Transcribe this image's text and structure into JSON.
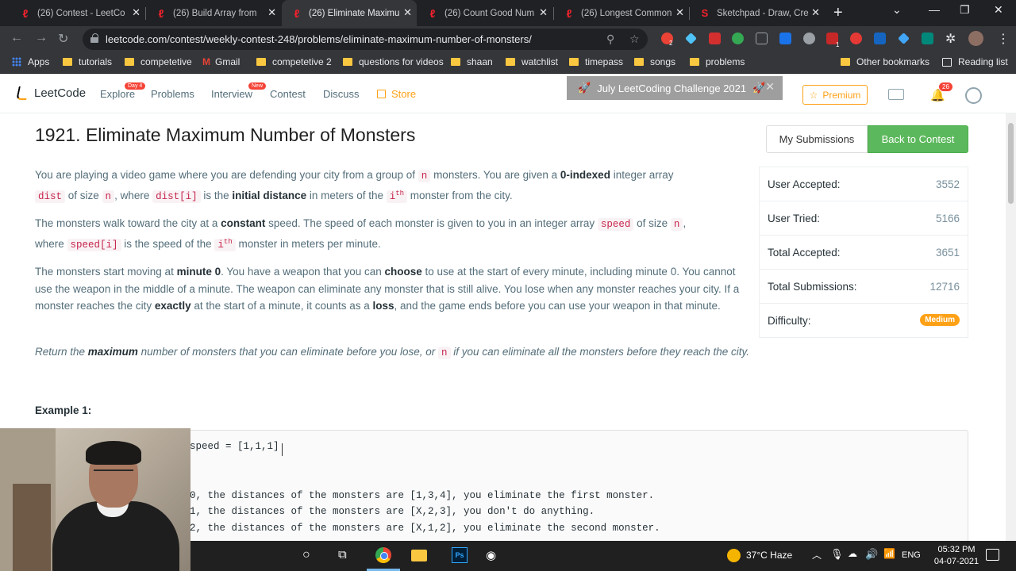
{
  "browser": {
    "tabs": [
      {
        "label": "(26) Contest - LeetCo",
        "favicon": "leetcode-icon"
      },
      {
        "label": "(26) Build Array from",
        "favicon": "leetcode-icon"
      },
      {
        "label": "(26) Eliminate Maximu",
        "favicon": "leetcode-icon",
        "active": true
      },
      {
        "label": "(26) Count Good Num",
        "favicon": "leetcode-icon"
      },
      {
        "label": "(26) Longest Common",
        "favicon": "leetcode-icon"
      },
      {
        "label": "Sketchpad - Draw, Cre",
        "favicon": "sketchpad-icon"
      }
    ],
    "url": "leetcode.com/contest/weekly-contest-248/problems/eliminate-maximum-number-of-monsters/",
    "bookmarks": [
      {
        "label": "Apps",
        "icon": "apps-grid-icon"
      },
      {
        "label": "tutorials",
        "icon": "folder-icon"
      },
      {
        "label": "competetive",
        "icon": "folder-icon"
      },
      {
        "label": "Gmail",
        "icon": "gmail-icon"
      },
      {
        "label": "competetive 2",
        "icon": "folder-icon"
      },
      {
        "label": "questions for videos",
        "icon": "folder-icon"
      },
      {
        "label": "shaan",
        "icon": "folder-icon"
      },
      {
        "label": "watchlist",
        "icon": "folder-icon"
      },
      {
        "label": "timepass",
        "icon": "folder-icon"
      },
      {
        "label": "songs",
        "icon": "folder-icon"
      },
      {
        "label": "problems",
        "icon": "folder-icon"
      },
      {
        "label": "Other bookmarks",
        "icon": "folder-icon"
      },
      {
        "label": "Reading list",
        "icon": "reading-list-icon"
      }
    ],
    "extension_badges": {
      "first": "2",
      "second": "1"
    }
  },
  "nav": {
    "logo": "LeetCode",
    "links": {
      "explore": "Explore",
      "problems": "Problems",
      "interview": "Interview",
      "contest": "Contest",
      "discuss": "Discuss",
      "store": "Store"
    },
    "badges": {
      "explore": "Day 4",
      "interview": "New"
    },
    "banner": "July LeetCoding Challenge 2021",
    "premium": "Premium",
    "notification_count": "26"
  },
  "problem": {
    "title": "1921. Eliminate Maximum Number of Monsters",
    "actions": {
      "submissions": "My Submissions",
      "back": "Back to Contest"
    },
    "p1": {
      "a": "You are playing a video game where you are defending your city from a group of ",
      "n": "n",
      "b": " monsters. You are given a ",
      "bold1": "0-indexed",
      "c": " integer array",
      "dist": "dist",
      "d": " of size ",
      "n2": "n",
      "e": ", where ",
      "disti": "dist[i]",
      "f": " is the ",
      "bold2": "initial distance",
      "g": " in meters of the ",
      "i": "i",
      "th": "th",
      "h": " monster from the city."
    },
    "p2": {
      "a": "The monsters walk toward the city at a ",
      "bold1": "constant",
      "b": " speed. The speed of each monster is given to you in an integer array ",
      "speed": "speed",
      "c": " of size ",
      "n": "n",
      "d": ",",
      "e": "where ",
      "speedi": "speed[i]",
      "f": " is the speed of the ",
      "i": "i",
      "th": "th",
      "g": " monster in meters per minute."
    },
    "p3": {
      "a": "The monsters start moving at ",
      "bold1": "minute 0",
      "b": ". You have a weapon that you can ",
      "bold2": "choose",
      "c": " to use at the start of every minute, including minute 0. You cannot use the weapon in the middle of a minute. The weapon can eliminate any monster that is still alive. You lose when any monster reaches your city. If a monster reaches the city ",
      "bold3": "exactly",
      "d": " at the start of a minute, it counts as a ",
      "bold4": "loss",
      "e": ", and the game ends before you can use your weapon in that minute."
    },
    "p4": {
      "a": "Return the ",
      "bold1": "maximum",
      "b": " number of monsters that you can eliminate before you lose, or ",
      "n": "n",
      "c": " if you can eliminate all the monsters before they reach the city."
    },
    "example_title": "Example 1:",
    "example_lines": [
      "speed = [1,1,1]",
      "0, the distances of the monsters are [1,3,4], you eliminate the first monster.",
      "1, the distances of the monsters are [X,2,3], you don't do anything.",
      "2, the distances of the monsters are [X,1,2], you eliminate the second monster."
    ]
  },
  "stats": [
    {
      "label": "User Accepted:",
      "value": "3552"
    },
    {
      "label": "User Tried:",
      "value": "5166"
    },
    {
      "label": "Total Accepted:",
      "value": "3651"
    },
    {
      "label": "Total Submissions:",
      "value": "12716"
    },
    {
      "label": "Difficulty:",
      "value": "Medium"
    }
  ],
  "taskbar": {
    "weather": "37°C  Haze",
    "language": "ENG",
    "time": "05:32 PM",
    "date": "04-07-2021"
  },
  "colors": {
    "accent": "#ffa116",
    "success": "#5cb85c",
    "danger": "#f44336"
  }
}
